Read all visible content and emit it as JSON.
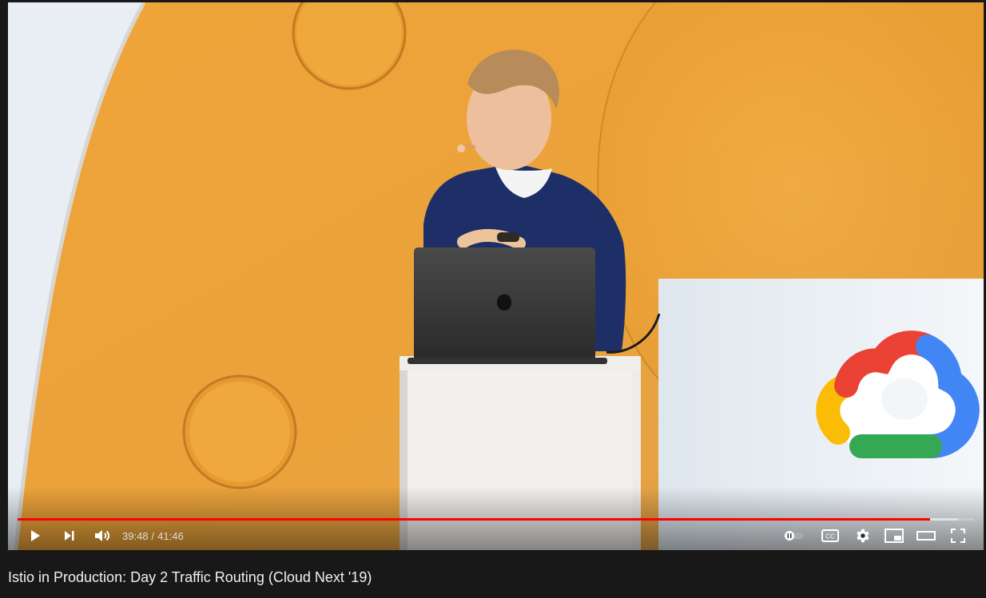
{
  "player": {
    "current_time": "39:48",
    "time_separator": "/",
    "duration": "41:46",
    "progress": 0.954,
    "buffered": 0.983,
    "colors": {
      "played": "#ff0000",
      "buffered": "#ffffff73",
      "track": "#ffffff38"
    },
    "controls": {
      "left": [
        "play-icon",
        "next-icon",
        "volume-icon"
      ],
      "right": [
        "autoplay-toggle-icon",
        "captions-icon",
        "settings-icon",
        "miniplayer-icon",
        "theater-mode-icon",
        "fullscreen-icon"
      ]
    },
    "captions_label": "CC"
  },
  "video": {
    "title": "Istio in Production: Day 2 Traffic Routing (Cloud Next '19)"
  }
}
